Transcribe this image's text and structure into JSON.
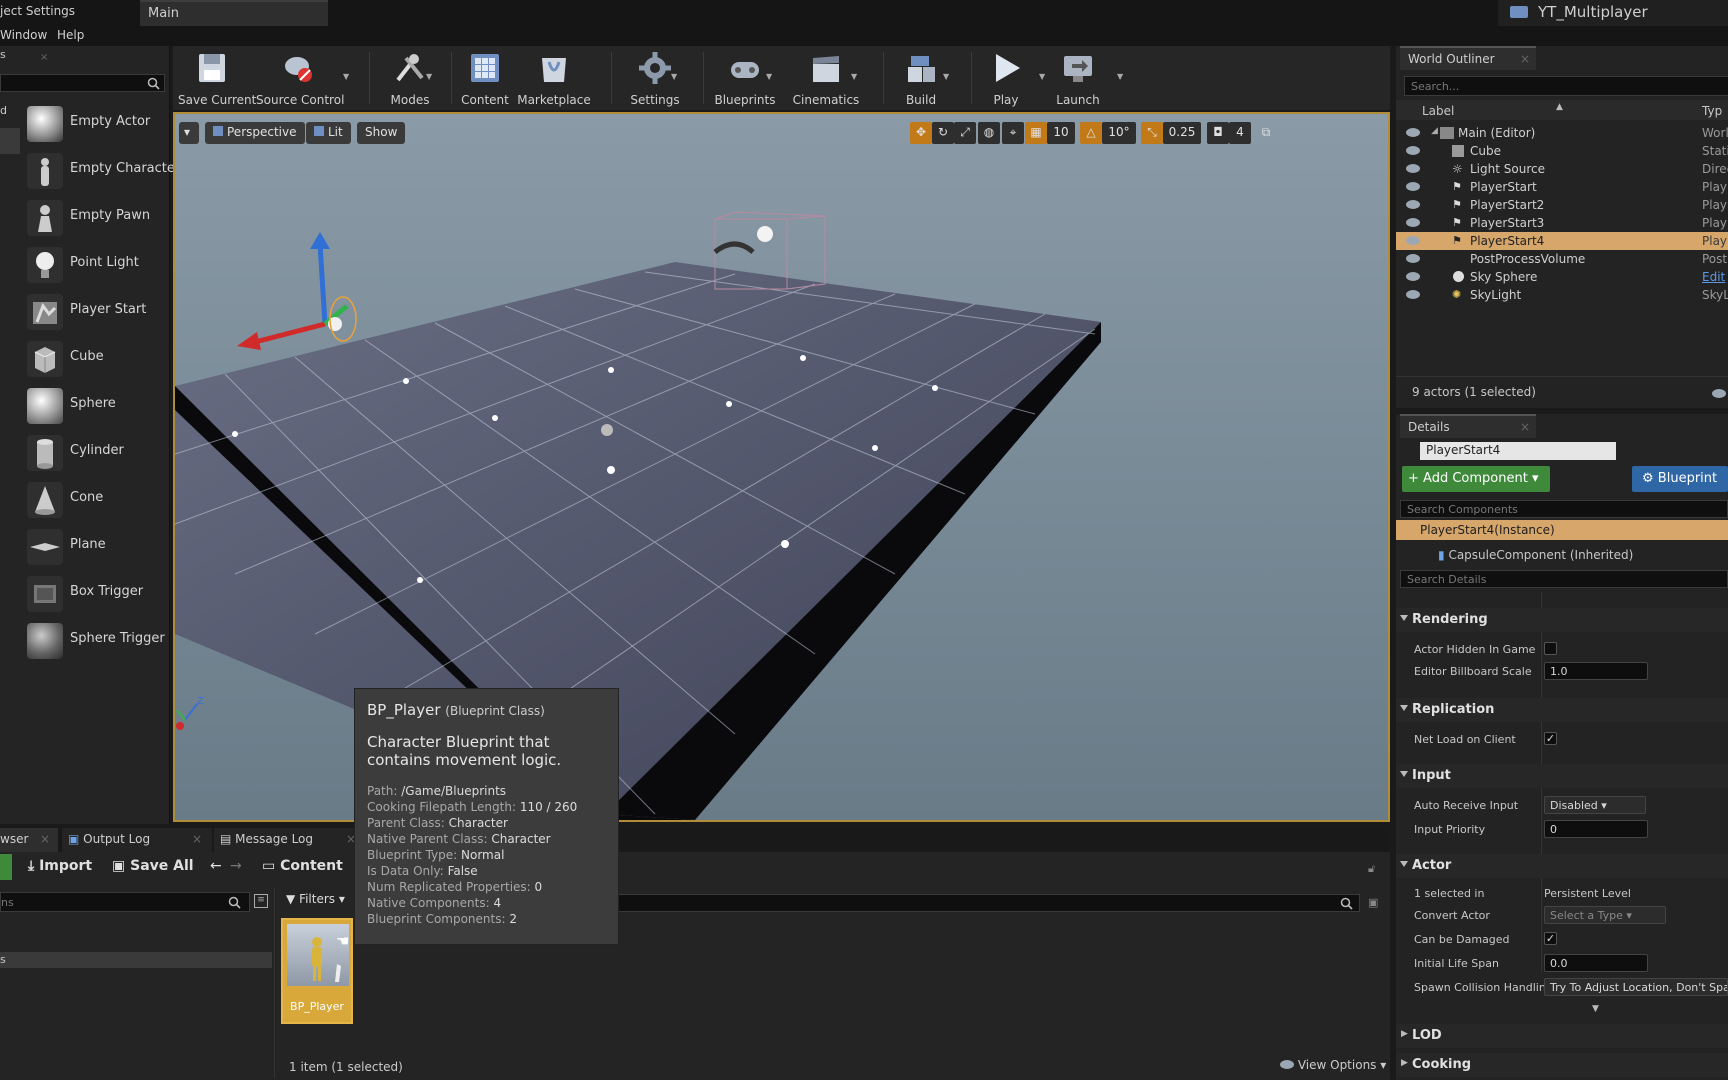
{
  "window": {
    "settings_tab": "ject Settings",
    "doc_tab": "Main",
    "project_name": "YT_Multiplayer"
  },
  "menubar": {
    "items": [
      "Window",
      "Help"
    ]
  },
  "placer": {
    "tab": "s",
    "side_labels": [
      "d"
    ],
    "items": [
      "Empty Actor",
      "Empty Characte",
      "Empty Pawn",
      "Point Light",
      "Player Start",
      "Cube",
      "Sphere",
      "Cylinder",
      "Cone",
      "Plane",
      "Box Trigger",
      "Sphere Trigger"
    ]
  },
  "toolbar": {
    "buttons": [
      "Save Current",
      "Source Control",
      "Modes",
      "Content",
      "Marketplace",
      "Settings",
      "Blueprints",
      "Cinematics",
      "Build",
      "Play",
      "Launch"
    ]
  },
  "viewport": {
    "perspective": "Perspective",
    "lit": "Lit",
    "show": "Show",
    "grid_snap": "10",
    "rotation_snap": "10°",
    "scale_snap": "0.25",
    "camera_speed": "4",
    "axis_z": "Z"
  },
  "outliner": {
    "title": "World Outliner",
    "search_placeholder": "Search...",
    "col_label": "Label",
    "col_type": "Typ",
    "rows": [
      {
        "label": "Main (Editor)",
        "type": "Worl",
        "selected": false
      },
      {
        "label": "Cube",
        "type": "Stati",
        "selected": false
      },
      {
        "label": "Light Source",
        "type": "Direc",
        "selected": false
      },
      {
        "label": "PlayerStart",
        "type": "Play",
        "selected": false
      },
      {
        "label": "PlayerStart2",
        "type": "Play",
        "selected": false
      },
      {
        "label": "PlayerStart3",
        "type": "Play",
        "selected": false
      },
      {
        "label": "PlayerStart4",
        "type": "Play",
        "selected": true
      },
      {
        "label": "PostProcessVolume",
        "type": "Post",
        "selected": false
      },
      {
        "label": "Sky Sphere",
        "type": "Edit",
        "selected": false
      },
      {
        "label": "SkyLight",
        "type": "SkyL",
        "selected": false
      }
    ],
    "footer": "9 actors (1 selected)"
  },
  "details": {
    "title": "Details",
    "name_value": "PlayerStart4",
    "add_component": "+ Add Component",
    "blueprint": "Blueprint",
    "search_components": "Search Components",
    "instance": "PlayerStart4(Instance)",
    "capsule": "CapsuleComponent (Inherited)",
    "search_details": "Search Details",
    "sections": {
      "rendering": "Rendering",
      "replication": "Replication",
      "input": "Input",
      "actor": "Actor",
      "lod": "LOD",
      "cooking": "Cooking"
    },
    "props": {
      "actor_hidden": "Actor Hidden In Game",
      "billboard_scale": "Editor Billboard Scale",
      "billboard_scale_val": "1.0",
      "net_load": "Net Load on Client",
      "auto_receive": "Auto Receive Input",
      "auto_receive_val": "Disabled",
      "input_priority": "Input Priority",
      "input_priority_val": "0",
      "selected_in": "1 selected in",
      "persistent_level": "Persistent Level",
      "convert_actor": "Convert Actor",
      "convert_actor_val": "Select a Type",
      "can_be_damaged": "Can be Damaged",
      "initial_life_span": "Initial Life Span",
      "initial_life_span_val": "0.0",
      "spawn_collision": "Spawn Collision Handling",
      "spawn_collision_val": "Try To Adjust Location, Don't Spawn"
    }
  },
  "bottom_tabs": {
    "browser": "wser",
    "output_log": "Output Log",
    "message_log": "Message Log"
  },
  "content_browser": {
    "import": "Import",
    "save_all": "Save All",
    "content": "Content",
    "filters": "Filters",
    "left_search": "ns",
    "left_item": "s",
    "asset_name": "BP_Player",
    "status": "1 item (1 selected)",
    "view_options": "View Options"
  },
  "tooltip": {
    "name": "BP_Player",
    "class": "(Blueprint Class)",
    "description": "Character Blueprint that contains movement logic.",
    "props": [
      {
        "k": "Path:",
        "v": "/Game/Blueprints"
      },
      {
        "k": "Cooking Filepath Length:",
        "v": "110 / 260"
      },
      {
        "k": "Parent Class:",
        "v": "Character"
      },
      {
        "k": "Native Parent Class:",
        "v": "Character"
      },
      {
        "k": "Blueprint Type:",
        "v": "Normal"
      },
      {
        "k": "Is Data Only:",
        "v": "False"
      },
      {
        "k": "Num Replicated Properties:",
        "v": "0"
      },
      {
        "k": "Native Components:",
        "v": "4"
      },
      {
        "k": "Blueprint Components:",
        "v": "2"
      }
    ]
  }
}
